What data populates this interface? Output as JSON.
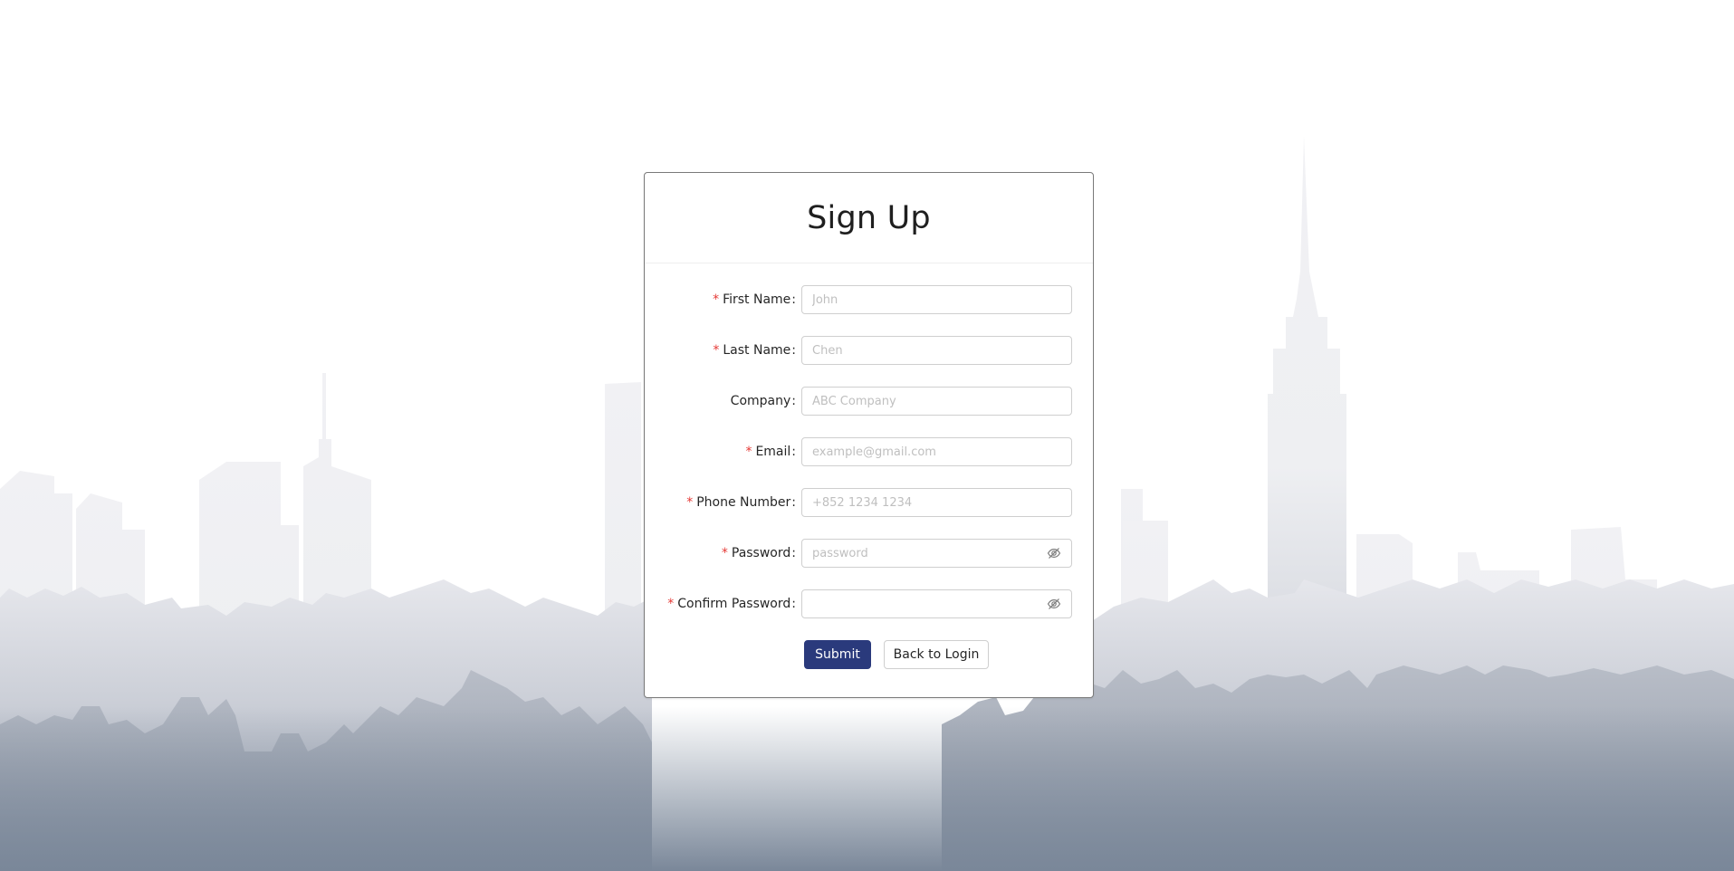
{
  "page": {
    "title": "Sign Up"
  },
  "form": {
    "fields": [
      {
        "key": "first_name",
        "label": "First Name",
        "required": true,
        "placeholder": "John",
        "value": ""
      },
      {
        "key": "last_name",
        "label": "Last Name",
        "required": true,
        "placeholder": "Chen",
        "value": ""
      },
      {
        "key": "company",
        "label": "Company",
        "required": false,
        "placeholder": "ABC Company",
        "value": ""
      },
      {
        "key": "email",
        "label": "Email",
        "required": true,
        "placeholder": "example@gmail.com",
        "value": ""
      },
      {
        "key": "phone",
        "label": "Phone Number",
        "required": true,
        "placeholder": "+852 1234 1234",
        "value": ""
      },
      {
        "key": "password",
        "label": "Password",
        "required": true,
        "placeholder": "password",
        "value": ""
      },
      {
        "key": "confirm_password",
        "label": "Confirm Password",
        "required": true,
        "placeholder": "",
        "value": ""
      }
    ],
    "required_mark": "*",
    "label_suffix": ":",
    "password_toggle_icon": "eye-invisible-icon"
  },
  "actions": {
    "submit_label": "Submit",
    "back_label": "Back to Login"
  },
  "theme": {
    "primary": "#2a3a7c",
    "required": "#e53935",
    "card_border": "#7a7a7a"
  }
}
